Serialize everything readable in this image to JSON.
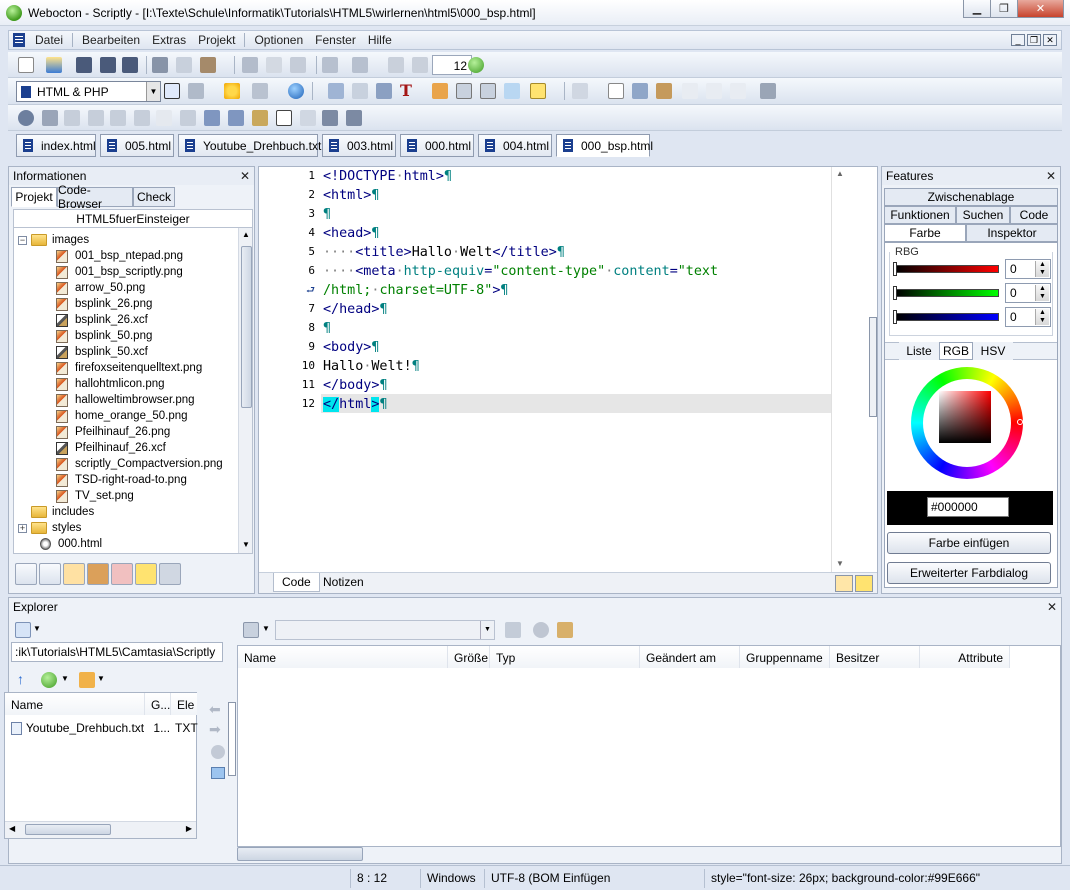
{
  "window": {
    "title": "Webocton - Scriptly - [I:\\Texte\\Schule\\Informatik\\Tutorials\\HTML5\\wirlernen\\html5\\000_bsp.html]"
  },
  "menu": {
    "items": [
      "Datei",
      "Bearbeiten",
      "Extras",
      "Projekt",
      "Optionen",
      "Fenster",
      "Hilfe"
    ]
  },
  "toolbar": {
    "font_size_value": "12",
    "language_select": "HTML & PHP"
  },
  "tabs": [
    "index.html",
    "005.html",
    "Youtube_Drehbuch.txt",
    "003.html",
    "000.html",
    "004.html",
    "000_bsp.html"
  ],
  "info_panel": {
    "title": "Informationen",
    "subtabs": [
      "Projekt",
      "Code-Browser",
      "Check"
    ],
    "project_name": "HTML5fuerEinsteiger",
    "tree": [
      {
        "label": "images",
        "type": "folder",
        "expander": "−"
      },
      {
        "label": "001_bsp_ntepad.png",
        "type": "png"
      },
      {
        "label": "001_bsp_scriptly.png",
        "type": "png"
      },
      {
        "label": "arrow_50.png",
        "type": "png"
      },
      {
        "label": "bsplink_26.png",
        "type": "png"
      },
      {
        "label": "bsplink_26.xcf",
        "type": "xcf"
      },
      {
        "label": "bsplink_50.png",
        "type": "png"
      },
      {
        "label": "bsplink_50.xcf",
        "type": "xcf"
      },
      {
        "label": "firefoxseitenquelltext.png",
        "type": "png"
      },
      {
        "label": "hallohtmlicon.png",
        "type": "png"
      },
      {
        "label": "halloweltimbrowser.png",
        "type": "png"
      },
      {
        "label": "home_orange_50.png",
        "type": "png"
      },
      {
        "label": "Pfeilhinauf_26.png",
        "type": "png"
      },
      {
        "label": "Pfeilhinauf_26.xcf",
        "type": "xcf"
      },
      {
        "label": "scriptly_Compactversion.png",
        "type": "png"
      },
      {
        "label": "TSD-right-road-to.png",
        "type": "png"
      },
      {
        "label": "TV_set.png",
        "type": "png"
      },
      {
        "label": "includes",
        "type": "folder"
      },
      {
        "label": "styles",
        "type": "folder",
        "expander": "+"
      },
      {
        "label": "000.html",
        "type": "html"
      }
    ]
  },
  "editor": {
    "bottom_tabs": [
      "Code",
      "Notizen"
    ],
    "line_numbers": [
      "1",
      "2",
      "3",
      "4",
      "5",
      "6",
      "",
      "7",
      "8",
      "9",
      "10",
      "11",
      "12"
    ]
  },
  "features": {
    "title": "Features",
    "tabs_row1": [
      "Zwischenablage"
    ],
    "tabs_row2": [
      "Funktionen",
      "Suchen",
      "Code"
    ],
    "tabs_row3": [
      "Farbe",
      "Inspektor"
    ],
    "group_label": "RBG",
    "r_value": "0",
    "g_value": "0",
    "b_value": "0",
    "mode_tabs": [
      "Liste",
      "RGB",
      "HSV"
    ],
    "hex_value": "#000000",
    "btn_insert": "Farbe einfügen",
    "btn_dialog": "Erweiterter Farbdialog"
  },
  "explorer": {
    "title": "Explorer",
    "path": ":ik\\Tutorials\\HTML5\\Camtasia\\Scriptly",
    "left_columns": [
      "Name",
      "G...",
      "Ele"
    ],
    "left_rows": [
      {
        "name": "Youtube_Drehbuch.txt",
        "size": "1...",
        "type": "TXT"
      }
    ],
    "right_columns": [
      "Name",
      "Größe",
      "Typ",
      "Geändert am",
      "Gruppenname",
      "Besitzer",
      "Attribute"
    ]
  },
  "statusbar": {
    "position": "8 : 12",
    "line_ending": "Windows",
    "encoding": "UTF-8 (BOM Einfügen",
    "info": "style=\"font-size: 26px; background-color:#99E666\""
  },
  "colors": {
    "tag": "#000080",
    "attribute": "#008080",
    "string": "#008000",
    "highlight": "#00e5ee"
  }
}
